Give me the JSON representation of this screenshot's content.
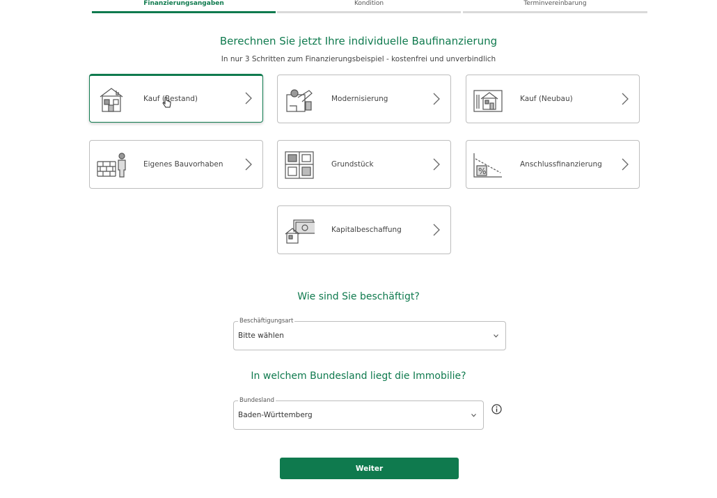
{
  "stepper": {
    "steps": [
      {
        "label": "Finanzierungsangaben",
        "active": true
      },
      {
        "label": "Kondition",
        "active": false
      },
      {
        "label": "Terminvereinbarung",
        "active": false
      }
    ]
  },
  "heading": "Berechnen Sie jetzt Ihre individuelle Baufinanzierung",
  "subtitle": "In nur 3 Schritten zum Finanzierungsbeispiel - kostenfrei und unverbindlich",
  "options": [
    {
      "label": "Kauf (Bestand)",
      "icon": "house-existing-icon",
      "selected": true
    },
    {
      "label": "Modernisierung",
      "icon": "renovation-icon",
      "selected": false
    },
    {
      "label": "Kauf (Neubau)",
      "icon": "new-building-icon",
      "selected": false
    },
    {
      "label": "Eigenes Bauvorhaben",
      "icon": "builder-bricks-icon",
      "selected": false
    },
    {
      "label": "Grundstück",
      "icon": "property-plot-icon",
      "selected": false
    },
    {
      "label": "Anschlussfinanzierung",
      "icon": "percentage-chart-icon",
      "selected": false
    },
    {
      "label": "Kapitalbeschaffung",
      "icon": "capital-money-icon",
      "selected": false
    }
  ],
  "employment": {
    "question": "Wie sind Sie beschäftigt?",
    "field_label": "Beschäftigungsart",
    "value": "Bitte wählen"
  },
  "state": {
    "question": "In welchem Bundesland liegt die Immobilie?",
    "field_label": "Bundesland",
    "value": "Baden-Württemberg"
  },
  "continue_label": "Weiter",
  "colors": {
    "accent": "#0f7a4e",
    "border": "#bdbdbd"
  }
}
